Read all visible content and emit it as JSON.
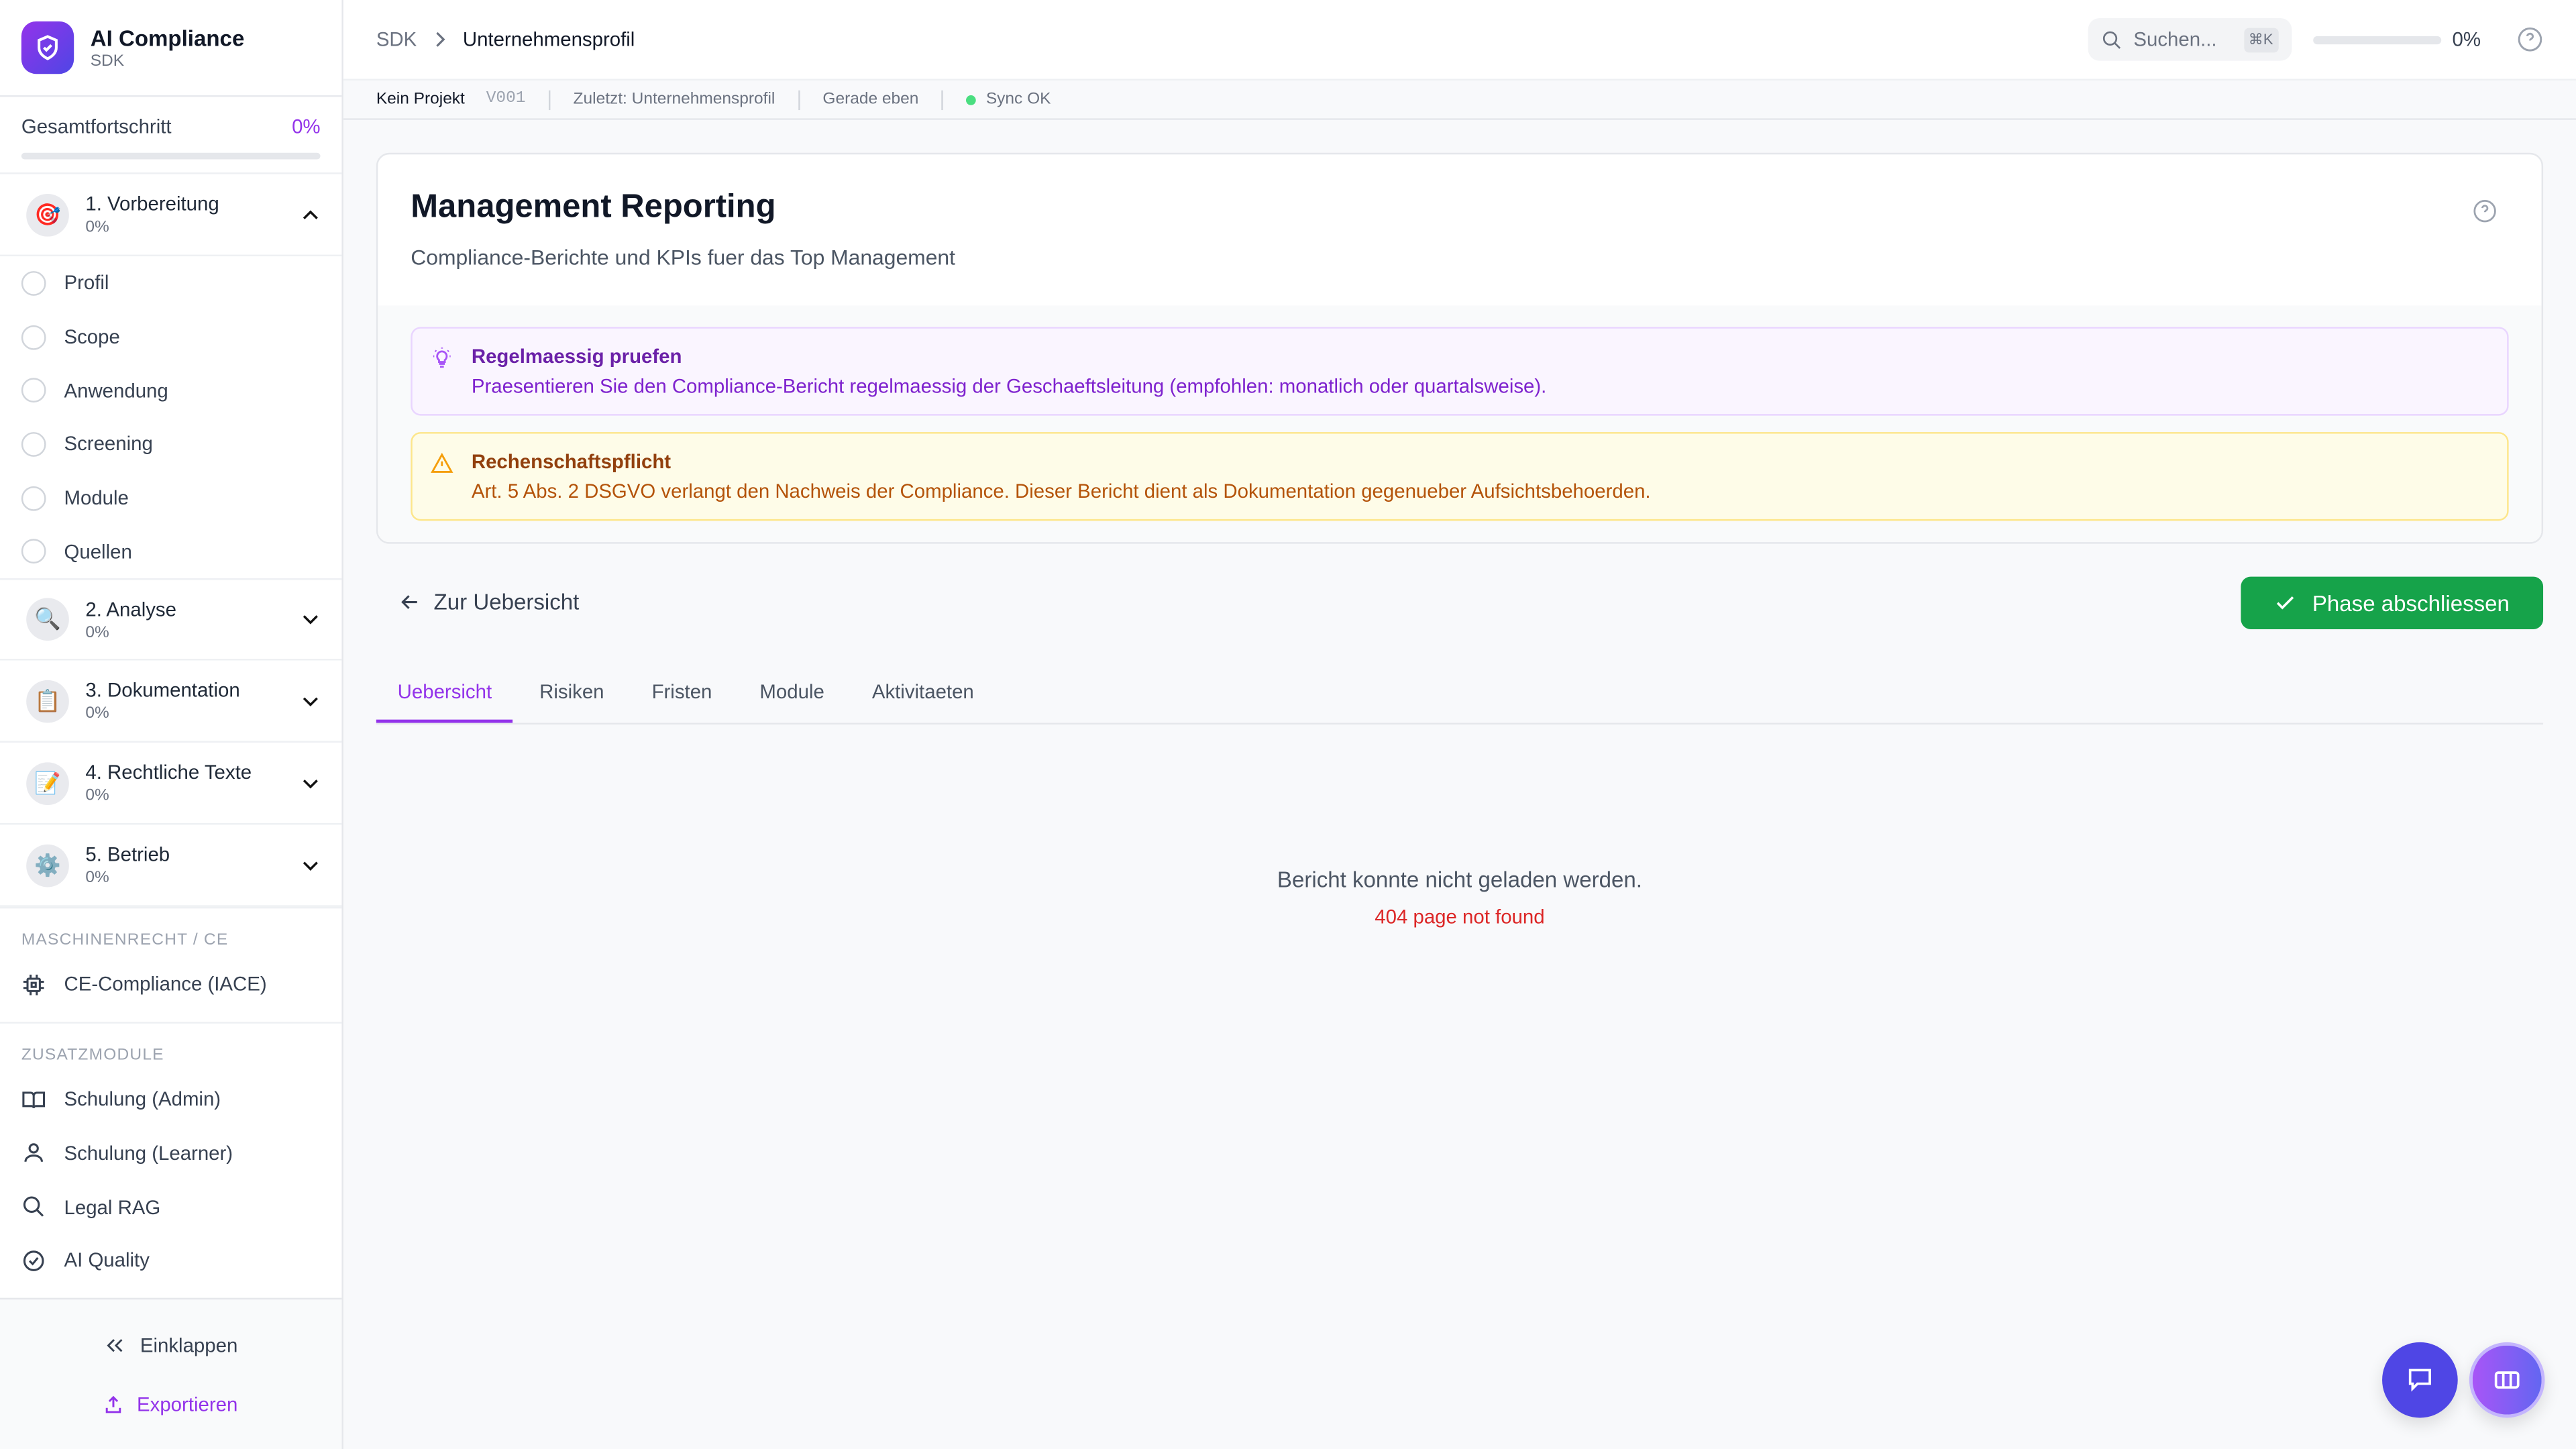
{
  "brand": {
    "title": "AI Compliance",
    "subtitle": "SDK",
    "icon": "shield-check-icon"
  },
  "progress": {
    "label": "Gesamtfortschritt",
    "value": "0%",
    "fraction": 0
  },
  "phases": [
    {
      "label": "1. Vorbereitung",
      "pct": "0%",
      "icon": "🎯",
      "expanded": true
    },
    {
      "label": "2. Analyse",
      "pct": "0%",
      "icon": "🔍"
    },
    {
      "label": "3. Dokumentation",
      "pct": "0%",
      "icon": "📋"
    },
    {
      "label": "4. Rechtliche Texte",
      "pct": "0%",
      "icon": "📝"
    },
    {
      "label": "5. Betrieb",
      "pct": "0%",
      "icon": "⚙️"
    }
  ],
  "steps": [
    "Profil",
    "Scope",
    "Anwendung",
    "Screening",
    "Module",
    "Quellen"
  ],
  "sections": {
    "machine": "MASCHINENRECHT / CE",
    "addons": "ZUSATZMODULE"
  },
  "machine_items": [
    "CE-Compliance (IACE)"
  ],
  "addon_items": [
    "Schulung (Admin)",
    "Schulung (Learner)",
    "Legal RAG",
    "AI Quality"
  ],
  "footer": {
    "collapse": "Einklappen",
    "export": "Exportieren"
  },
  "header": {
    "crumb_root": "SDK",
    "crumb_current": "Unternehmensprofil",
    "search_placeholder": "Suchen...",
    "shortcut": "⌘K",
    "progress": "0%"
  },
  "status": {
    "project": "Kein Projekt",
    "version": "V001",
    "last": "Zuletzt: Unternehmensprofil",
    "time": "Gerade eben",
    "sync": "Sync OK"
  },
  "page": {
    "title": "Management Reporting",
    "description": "Compliance-Berichte und KPIs fuer das Top Management"
  },
  "alerts": [
    {
      "title": "Regelmaessig pruefen",
      "body": "Praesentieren Sie den Compliance-Bericht regelmaessig der Geschaeftsleitung (empfohlen: monatlich oder quartalsweise)."
    },
    {
      "title": "Rechenschaftspflicht",
      "body": "Art. 5 Abs. 2 DSGVO verlangt den Nachweis der Compliance. Dieser Bericht dient als Dokumentation gegenueber Aufsichtsbehoerden."
    }
  ],
  "actions": {
    "back": "Zur Uebersicht",
    "complete": "Phase abschliessen"
  },
  "tabs": [
    "Uebersicht",
    "Risiken",
    "Fristen",
    "Module",
    "Aktivitaeten"
  ],
  "error": {
    "message": "Bericht konnte nicht geladen werden.",
    "detail": "404 page not found"
  },
  "colors": {
    "accent": "#9333ea",
    "success": "#16a34a",
    "error": "#dc2626",
    "chat": "#4f46e5"
  }
}
